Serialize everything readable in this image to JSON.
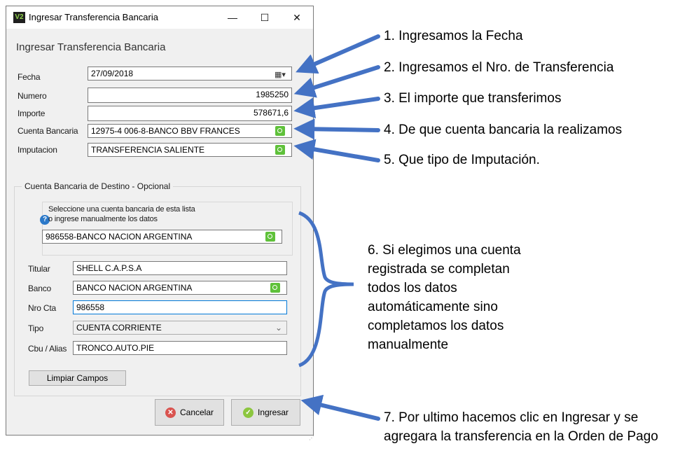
{
  "window": {
    "app_icon_text": "V2",
    "title": "Ingresar Transferencia Bancaria",
    "controls": {
      "minimize": "—",
      "maximize": "☐",
      "close": "✕"
    }
  },
  "form": {
    "header": "Ingresar Transferencia Bancaria",
    "fecha": {
      "label": "Fecha",
      "value": "27/09/2018"
    },
    "numero": {
      "label": "Numero",
      "value": "1985250"
    },
    "importe": {
      "label": "Importe",
      "value": "578671,6"
    },
    "cuenta_bancaria": {
      "label": "Cuenta Bancaria",
      "value": "12975-4 006-8-BANCO BBV FRANCES"
    },
    "imputacion": {
      "label": "Imputacion",
      "value": "TRANSFERENCIA SALIENTE"
    }
  },
  "destino": {
    "group_title": "Cuenta Bancaria de Destino - Opcional",
    "hint_line1": "Seleccione una cuenta bancaria de esta lista",
    "hint_line2": "o ingrese manualmente los datos",
    "selector_value": "986558-BANCO NACION ARGENTINA",
    "titular": {
      "label": "Titular",
      "value": "SHELL C.A.P.S.A"
    },
    "banco": {
      "label": "Banco",
      "value": "BANCO NACION ARGENTINA"
    },
    "nro_cta": {
      "label": "Nro Cta",
      "value": "986558"
    },
    "tipo": {
      "label": "Tipo",
      "value": "CUENTA CORRIENTE"
    },
    "cbu": {
      "label": "Cbu / Alias",
      "value": "TRONCO.AUTO.PIE"
    },
    "limpiar_label": "Limpiar Campos"
  },
  "actions": {
    "cancel_label": "Cancelar",
    "submit_label": "Ingresar"
  },
  "annotations": [
    "1. Ingresamos la Fecha",
    "2. Ingresamos el Nro. de Transferencia",
    "3. El importe que transferimos",
    "4. De que cuenta bancaria la realizamos",
    "5. Que tipo de Imputación.",
    "6. Si elegimos una cuenta",
    "registrada se completan",
    "todos los datos",
    "automáticamente sino",
    "completamos los datos",
    "manualmente",
    "7. Por ultimo hacemos clic en Ingresar y se",
    "agregara la transferencia en la Orden de Pago"
  ],
  "colors": {
    "arrow": "#4472c4",
    "window_bg": "#f0f0f0",
    "search_button": "#5fc13a",
    "focus_border": "#0078d7"
  }
}
